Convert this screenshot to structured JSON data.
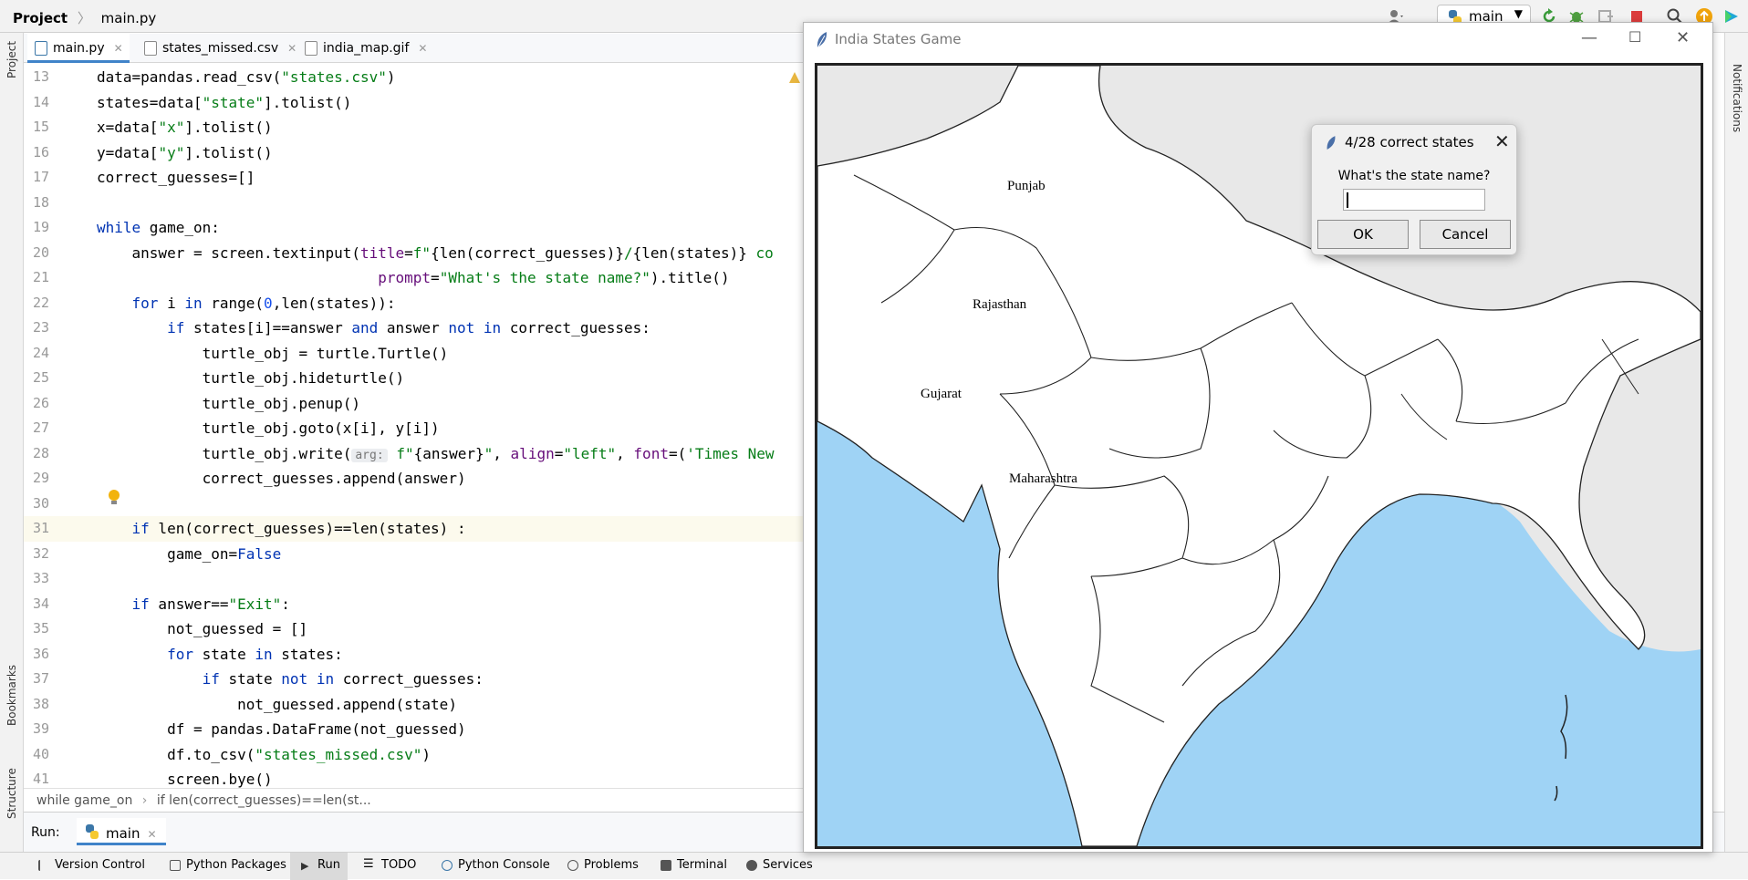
{
  "topbar": {
    "project": "Project",
    "file": "main.py",
    "branch": "main"
  },
  "left_strip": {
    "project": "Project",
    "bookmarks": "Bookmarks",
    "structure": "Structure"
  },
  "right_strip": {
    "notifications": "Notifications"
  },
  "tabs": [
    {
      "label": "main.py"
    },
    {
      "label": "states_missed.csv"
    },
    {
      "label": "india_map.gif"
    }
  ],
  "code_lines": [
    {
      "n": "13",
      "parts": [
        [
          "data=pandas.read_csv(",
          ""
        ],
        [
          "\"states.csv\"",
          "str"
        ],
        [
          ")",
          ""
        ]
      ]
    },
    {
      "n": "14",
      "parts": [
        [
          "states=data[",
          ""
        ],
        [
          "\"state\"",
          "str"
        ],
        [
          "].tolist()",
          ""
        ]
      ]
    },
    {
      "n": "15",
      "parts": [
        [
          "x=data[",
          ""
        ],
        [
          "\"x\"",
          "str"
        ],
        [
          "].tolist()",
          ""
        ]
      ]
    },
    {
      "n": "16",
      "parts": [
        [
          "y=data[",
          ""
        ],
        [
          "\"y\"",
          "str"
        ],
        [
          "].tolist()",
          ""
        ]
      ]
    },
    {
      "n": "17",
      "parts": [
        [
          "correct_guesses=[]",
          ""
        ]
      ]
    },
    {
      "n": "18",
      "parts": []
    },
    {
      "n": "19",
      "parts": [
        [
          "while",
          "kw"
        ],
        [
          " game_on:",
          ""
        ]
      ]
    },
    {
      "n": "20",
      "parts": [
        [
          "    answer = screen.textinput(",
          ""
        ],
        [
          "title",
          "param"
        ],
        [
          "=",
          ""
        ],
        [
          "f\"",
          "str"
        ],
        [
          "{len(correct_guesses)}",
          ""
        ],
        [
          "/",
          "str"
        ],
        [
          "{len(states)}",
          ""
        ],
        [
          " co",
          "str"
        ]
      ]
    },
    {
      "n": "21",
      "parts": [
        [
          "                                ",
          ""
        ],
        [
          "prompt",
          "param"
        ],
        [
          "=",
          ""
        ],
        [
          "\"What's the state name?\"",
          "str"
        ],
        [
          ").title()",
          ""
        ]
      ]
    },
    {
      "n": "22",
      "parts": [
        [
          "    ",
          ""
        ],
        [
          "for",
          "kw"
        ],
        [
          " i ",
          ""
        ],
        [
          "in",
          "kw"
        ],
        [
          " range(",
          ""
        ],
        [
          "0",
          "num"
        ],
        [
          ",len(states)):",
          ""
        ]
      ]
    },
    {
      "n": "23",
      "parts": [
        [
          "        ",
          ""
        ],
        [
          "if",
          "kw"
        ],
        [
          " states[i]==answer ",
          ""
        ],
        [
          "and",
          "kw"
        ],
        [
          " answer ",
          ""
        ],
        [
          "not in",
          "kw"
        ],
        [
          " correct_guesses:",
          ""
        ]
      ]
    },
    {
      "n": "24",
      "parts": [
        [
          "            turtle_obj = turtle.Turtle()",
          ""
        ]
      ]
    },
    {
      "n": "25",
      "parts": [
        [
          "            turtle_obj.hideturtle()",
          ""
        ]
      ]
    },
    {
      "n": "26",
      "parts": [
        [
          "            turtle_obj.penup()",
          ""
        ]
      ]
    },
    {
      "n": "27",
      "parts": [
        [
          "            turtle_obj.goto(x[i], y[i])",
          ""
        ]
      ]
    },
    {
      "n": "28",
      "parts": [
        [
          "            turtle_obj.write(",
          ""
        ],
        [
          "arg:",
          "hint"
        ],
        [
          " ",
          ""
        ],
        [
          "f\"",
          "str"
        ],
        [
          "{answer}",
          ""
        ],
        [
          "\"",
          "str"
        ],
        [
          ", ",
          ""
        ],
        [
          "align",
          "param"
        ],
        [
          "=",
          ""
        ],
        [
          "\"left\"",
          "str"
        ],
        [
          ", ",
          ""
        ],
        [
          "font",
          "param"
        ],
        [
          "=(",
          ""
        ],
        [
          "'Times New",
          "str"
        ]
      ]
    },
    {
      "n": "29",
      "parts": [
        [
          "            correct_guesses.append(answer)",
          ""
        ]
      ]
    },
    {
      "n": "30",
      "parts": []
    },
    {
      "n": "31",
      "parts": [
        [
          "    ",
          ""
        ],
        [
          "if",
          "kw"
        ],
        [
          " len(correct_guesses)==len(states) :",
          ""
        ]
      ]
    },
    {
      "n": "32",
      "parts": [
        [
          "        game_on=",
          ""
        ],
        [
          "False",
          "kw"
        ]
      ]
    },
    {
      "n": "33",
      "parts": []
    },
    {
      "n": "34",
      "parts": [
        [
          "    ",
          ""
        ],
        [
          "if",
          "kw"
        ],
        [
          " answer==",
          ""
        ],
        [
          "\"Exit\"",
          "str"
        ],
        [
          ":",
          ""
        ]
      ]
    },
    {
      "n": "35",
      "parts": [
        [
          "        not_guessed = []",
          ""
        ]
      ]
    },
    {
      "n": "36",
      "parts": [
        [
          "        ",
          ""
        ],
        [
          "for",
          "kw"
        ],
        [
          " state ",
          ""
        ],
        [
          "in",
          "kw"
        ],
        [
          " states:",
          ""
        ]
      ]
    },
    {
      "n": "37",
      "parts": [
        [
          "            ",
          ""
        ],
        [
          "if",
          "kw"
        ],
        [
          " state ",
          ""
        ],
        [
          "not in",
          "kw"
        ],
        [
          " correct_guesses:",
          ""
        ]
      ]
    },
    {
      "n": "38",
      "parts": [
        [
          "                not_guessed.append(state)",
          ""
        ]
      ]
    },
    {
      "n": "39",
      "parts": [
        [
          "        df = pandas.DataFrame(not_guessed)",
          ""
        ]
      ]
    },
    {
      "n": "40",
      "parts": [
        [
          "        df.to_csv(",
          ""
        ],
        [
          "\"states_missed.csv\"",
          "str"
        ],
        [
          ")",
          ""
        ]
      ]
    },
    {
      "n": "41",
      "parts": [
        [
          "        screen.bye()",
          ""
        ]
      ]
    }
  ],
  "editor_breadcrumb": {
    "first": "while game_on",
    "second": "if len(correct_guesses)==len(st..."
  },
  "run": {
    "label": "Run:",
    "config": "main"
  },
  "bottom_bar": [
    {
      "label": "Version Control"
    },
    {
      "label": "Python Packages"
    },
    {
      "label": "Run"
    },
    {
      "label": "TODO"
    },
    {
      "label": "Python Console"
    },
    {
      "label": "Problems"
    },
    {
      "label": "Terminal"
    },
    {
      "label": "Services"
    }
  ],
  "game_window": {
    "title": "India States Game",
    "labels": [
      "Punjab",
      "Rajasthan",
      "Gujarat",
      "Maharashtra"
    ]
  },
  "dialog": {
    "title": "4/28 correct states",
    "prompt": "What's the state name?",
    "input_value": "",
    "ok": "OK",
    "cancel": "Cancel"
  },
  "colors": {
    "accent": "#4083c9",
    "sea": "#9fd3f5",
    "keyword": "#0033b3",
    "string": "#067d17"
  }
}
